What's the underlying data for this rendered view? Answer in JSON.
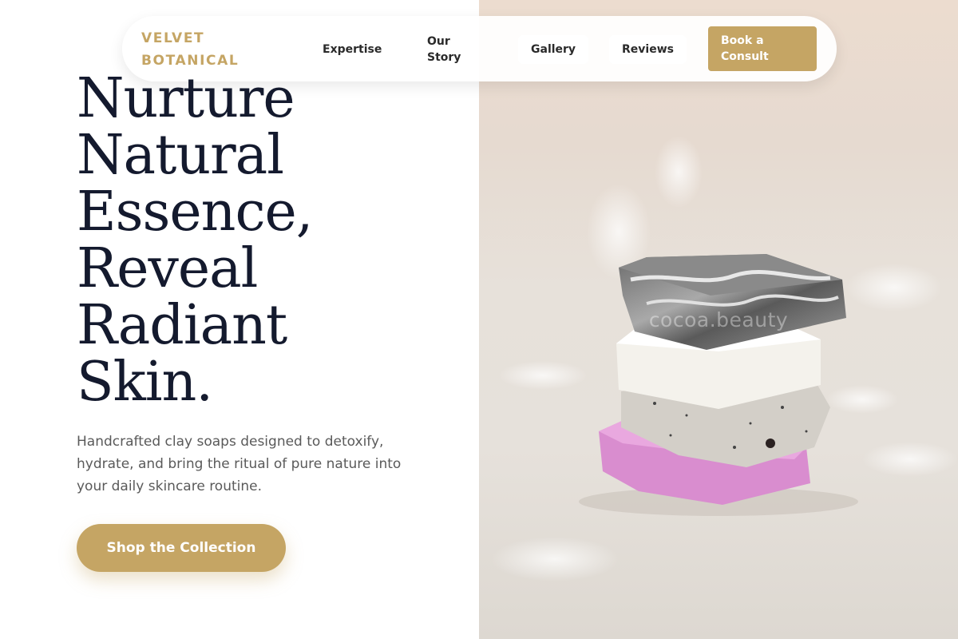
{
  "brand": {
    "name": "VELVET BOTANICAL",
    "color": "#c5a564"
  },
  "nav": {
    "links": [
      {
        "label": "Expertise"
      },
      {
        "label": "Our Story"
      },
      {
        "label": "Gallery"
      },
      {
        "label": "Reviews"
      }
    ],
    "cta_label": "Book a Consult"
  },
  "hero": {
    "headline_lines": [
      "Nurture",
      "Natural",
      "Essence,",
      "Reveal",
      "Radiant",
      "Skin."
    ],
    "subtext": "Handcrafted clay soaps designed to detoxify, hydrate, and bring the ritual of pure nature into your daily skincare routine.",
    "button_label": "Shop the Collection",
    "image_watermark": "cocoa.beauty"
  },
  "colors": {
    "accent": "#c5a564",
    "headline": "#141a2e",
    "body_text": "#5a5a5a"
  },
  "icons": {
    "hero_image": "soap-stack-photo"
  }
}
